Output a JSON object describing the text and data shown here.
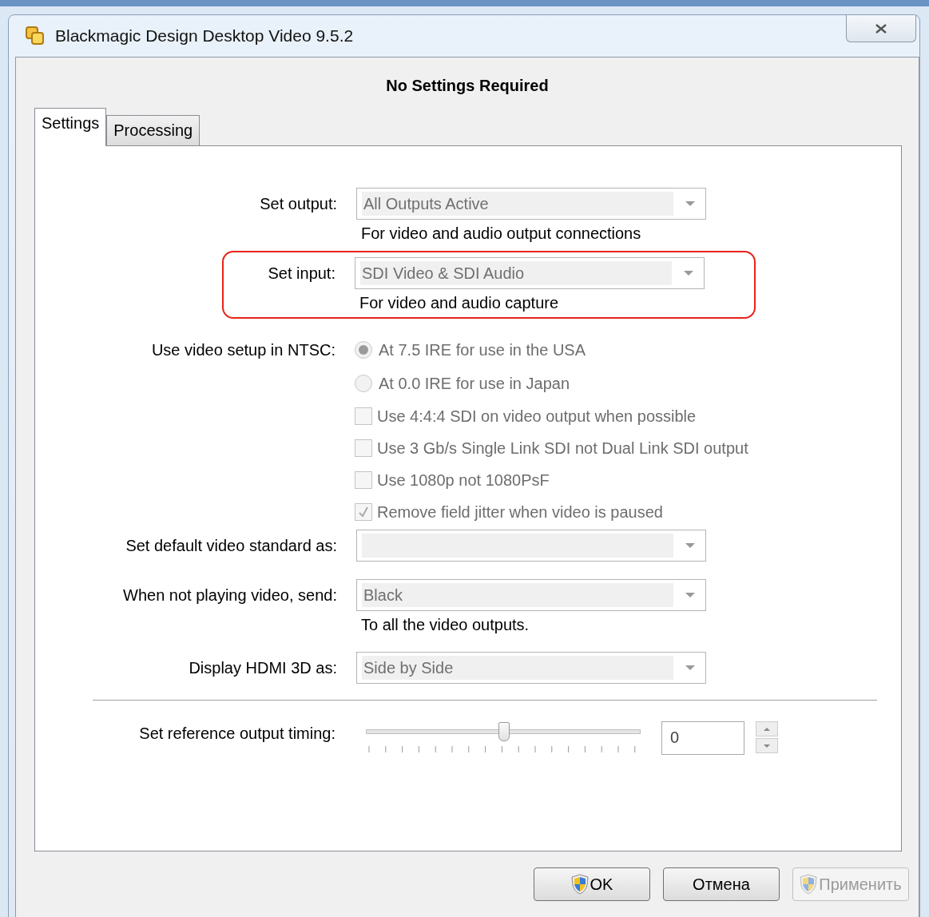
{
  "window": {
    "title": "Blackmagic Design Desktop Video 9.5.2"
  },
  "header": "No Settings Required",
  "tabs": [
    {
      "label": "Settings",
      "selected": true
    },
    {
      "label": "Processing",
      "selected": false
    }
  ],
  "rows": [
    {
      "kind": "dropdown",
      "label": "Set output:",
      "value": "All Outputs Active",
      "disabled": true,
      "note": "For video and audio output connections",
      "highlighted": false
    },
    {
      "kind": "dropdown",
      "label": "Set input:",
      "value": "SDI Video & SDI Audio",
      "disabled": true,
      "note": "For video and audio capture",
      "highlighted": true
    },
    {
      "kind": "radio",
      "label": "Use video setup in NTSC:",
      "text": "At 7.5 IRE for use in the USA",
      "selected": true,
      "disabled": true
    },
    {
      "kind": "radio",
      "text": "At 0.0 IRE for use in Japan",
      "selected": false,
      "disabled": true
    },
    {
      "kind": "checkbox",
      "text": "Use 4:4:4 SDI on video output when possible",
      "checked": false,
      "disabled": true
    },
    {
      "kind": "checkbox",
      "text": "Use 3 Gb/s Single Link SDI not Dual Link SDI output",
      "checked": false,
      "disabled": true
    },
    {
      "kind": "checkbox",
      "text": "Use 1080p not 1080PsF",
      "checked": false,
      "disabled": true
    },
    {
      "kind": "checkbox",
      "text": "Remove field jitter when video is paused",
      "checked": true,
      "disabled": true
    },
    {
      "kind": "dropdown",
      "label": "Set default video standard as:",
      "disabled": true,
      "highlighted": false
    },
    {
      "kind": "dropdown",
      "label": "When not playing video, send:",
      "value": "Black",
      "disabled": true,
      "note": "To all the video outputs.",
      "highlighted": false
    },
    {
      "kind": "dropdown",
      "label": "Display HDMI 3D as:",
      "value": "Side by Side",
      "disabled": true,
      "highlighted": false
    },
    {
      "kind": "divider"
    },
    {
      "kind": "slider",
      "label": "Set reference output timing:",
      "level": 0.5,
      "value": "0"
    }
  ],
  "buttons": [
    {
      "label": "OK",
      "shield": true,
      "disabled": false
    },
    {
      "label": "Отмена",
      "shield": false,
      "disabled": false
    },
    {
      "label": "Применить",
      "shield": true,
      "disabled": true
    }
  ]
}
